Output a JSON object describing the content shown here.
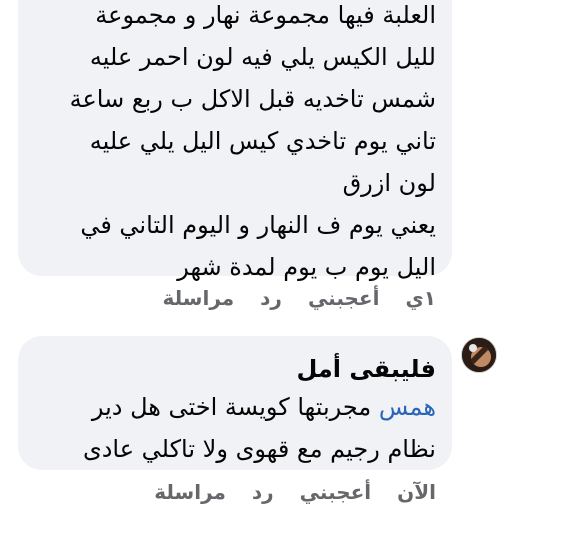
{
  "comment_1": {
    "lines": [
      "العلبة فيها مجموعة نهار و مجموعة",
      "لليل الكيس يلي فيه لون احمر عليه",
      "شمس تاخديه قبل الاكل ب ربع ساعة",
      "تاني يوم تاخدي كيس اليل يلي عليه",
      "لون ازرق",
      "يعني يوم ف النهار و اليوم التاني في",
      "اليل يوم ب يوم لمدة شهر"
    ],
    "time": "١ي",
    "like": "أعجبني",
    "reply": "رد",
    "message": "مراسلة"
  },
  "comment_2": {
    "author": "فليبقى أمل",
    "mention": "همس",
    "text_line_1": " مجربتها كويسة اختى هل دير",
    "text_line_2": "نظام رجيم مع قهوى ولا تاكلي عادى",
    "time": "الآن",
    "like": "أعجبني",
    "reply": "رد",
    "message": "مراسلة"
  }
}
